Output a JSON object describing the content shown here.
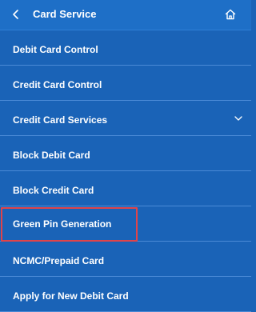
{
  "header": {
    "title": "Card Service",
    "back_icon": "chevron-left-icon",
    "home_icon": "home-icon"
  },
  "menu": {
    "items": [
      {
        "label": "Debit Card Control"
      },
      {
        "label": "Credit Card Control"
      },
      {
        "label": "Credit Card Services",
        "has_chevron": true
      },
      {
        "label": "Block Debit Card"
      },
      {
        "label": "Block Credit Card"
      },
      {
        "label": "Green Pin Generation",
        "highlighted": true
      },
      {
        "label": "NCMC/Prepaid Card"
      },
      {
        "label": "Apply for New Debit Card"
      }
    ]
  },
  "colors": {
    "background": "#1a63b7",
    "header": "#1e6fc7",
    "divider": "#4a8ad6",
    "highlight_border": "#e0444a",
    "text": "#ffffff"
  }
}
